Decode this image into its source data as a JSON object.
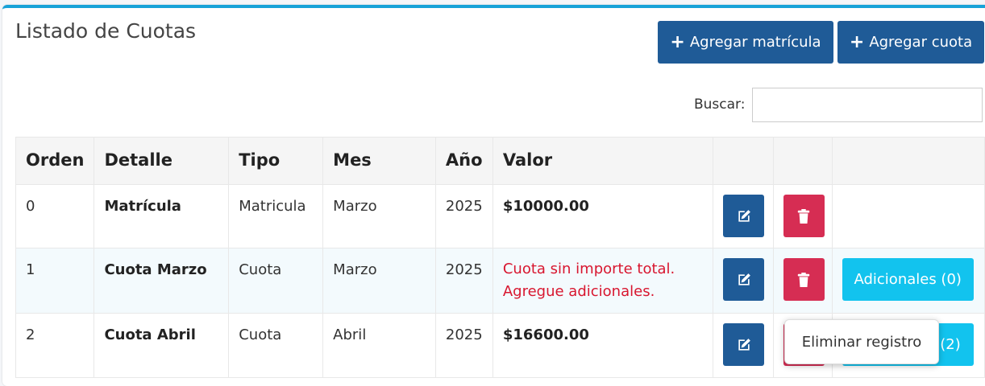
{
  "header": {
    "title": "Listado de Cuotas",
    "add_matricula_label": "Agregar matrícula",
    "add_cuota_label": "Agregar cuota"
  },
  "search": {
    "label": "Buscar:",
    "value": "",
    "placeholder": ""
  },
  "table": {
    "columns": [
      "Orden",
      "Detalle",
      "Tipo",
      "Mes",
      "Año",
      "Valor",
      "",
      "",
      ""
    ],
    "rows": [
      {
        "orden": "0",
        "detalle": "Matrícula",
        "tipo": "Matricula",
        "mes": "Marzo",
        "anio": "2025",
        "valor": "$10000.00"
      },
      {
        "orden": "1",
        "detalle": "Cuota Marzo",
        "tipo": "Cuota",
        "mes": "Marzo",
        "anio": "2025",
        "valor_warning_line1": "Cuota sin importe total.",
        "valor_warning_line2": "Agregue adicionales.",
        "adicionales_label": "Adicionales (0)"
      },
      {
        "orden": "2",
        "detalle": "Cuota Abril",
        "tipo": "Cuota",
        "mes": "Abril",
        "anio": "2025",
        "valor": "$16600.00",
        "adicionales_label": "(2)"
      }
    ]
  },
  "tooltip": {
    "text": "Eliminar registro"
  },
  "icons": {
    "edit": "edit-icon",
    "delete": "trash-icon",
    "plus": "plus-icon"
  },
  "colors": {
    "primary": "#1f5b97",
    "danger": "#d62d53",
    "info": "#12c3ee",
    "warning_text": "#d8162f",
    "accent_border": "#17a2d8"
  }
}
